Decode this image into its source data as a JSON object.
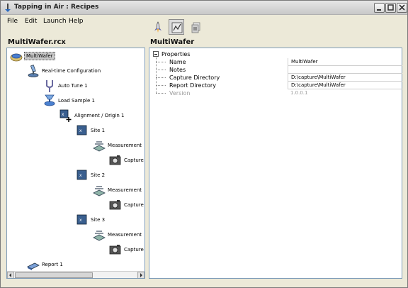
{
  "window": {
    "title": "Tapping in Air : Recipes"
  },
  "menu": [
    {
      "label": "File"
    },
    {
      "label": "Edit"
    },
    {
      "label": "Launch"
    },
    {
      "label": "Help"
    }
  ],
  "left_pane": {
    "title": "MultiWafer.rcx"
  },
  "right_pane": {
    "title": "MultiWafer"
  },
  "tree": [
    {
      "label": "MultiWafer",
      "icon": "wafer-icon"
    },
    {
      "label": "Real-time Configuration",
      "icon": "microscope-icon"
    },
    {
      "label": "Auto Tune 1",
      "icon": "tuning-fork-icon"
    },
    {
      "label": "Load Sample 1",
      "icon": "load-sample-icon"
    },
    {
      "label": "Alignment / Origin 1",
      "icon": "alignment-icon"
    },
    {
      "label": "Site 1",
      "icon": "site-icon"
    },
    {
      "label": "Measurement",
      "icon": "measurement-icon"
    },
    {
      "label": "Capture",
      "icon": "camera-icon"
    },
    {
      "label": "Site 2",
      "icon": "site-icon"
    },
    {
      "label": "Measurement",
      "icon": "measurement-icon"
    },
    {
      "label": "Capture",
      "icon": "camera-icon"
    },
    {
      "label": "Site 3",
      "icon": "site-icon"
    },
    {
      "label": "Measurement",
      "icon": "measurement-icon"
    },
    {
      "label": "Capture",
      "icon": "camera-icon"
    },
    {
      "label": "Report 1",
      "icon": "report-icon"
    }
  ],
  "properties": {
    "root_label": "Properties",
    "rows": [
      {
        "name": "Name",
        "value": "MultiWafer"
      },
      {
        "name": "Notes",
        "value": ""
      },
      {
        "name": "Capture Directory",
        "value": "D:\\capture\\MultiWafer"
      },
      {
        "name": "Report Directory",
        "value": "D:\\capture\\MultiWafer"
      },
      {
        "name": "Version",
        "value": "1.0.0.1"
      }
    ]
  },
  "toolbar": [
    {
      "icon": "rocket-launch-icon"
    },
    {
      "icon": "recipe-editor-icon"
    },
    {
      "icon": "pages-icon"
    }
  ]
}
